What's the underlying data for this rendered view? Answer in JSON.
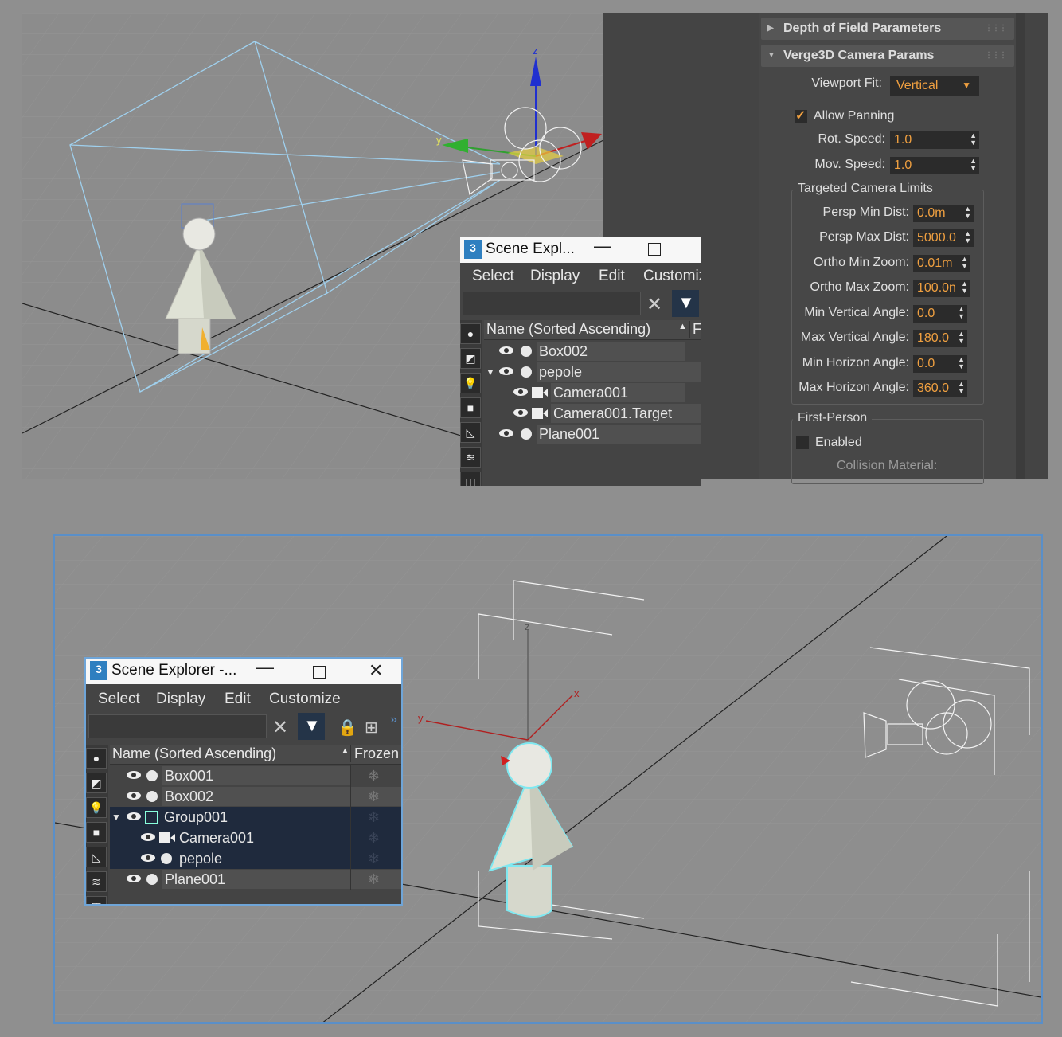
{
  "top_viewport": {
    "axis_labels": {
      "z": "z",
      "y": "y"
    }
  },
  "params_panel": {
    "rollouts": [
      {
        "label": "Depth of Field Parameters",
        "expanded": false
      },
      {
        "label": "Verge3D Camera Params",
        "expanded": true
      }
    ],
    "viewport_fit": {
      "label": "Viewport Fit:",
      "value": "Vertical"
    },
    "allow_panning": {
      "label": "Allow Panning",
      "checked": true
    },
    "rot_speed": {
      "label": "Rot. Speed:",
      "value": "1.0"
    },
    "mov_speed": {
      "label": "Mov. Speed:",
      "value": "1.0"
    },
    "targeted_limits": {
      "title": "Targeted Camera Limits",
      "fields": [
        {
          "label": "Persp Min Dist:",
          "value": "0.0m"
        },
        {
          "label": "Persp Max Dist:",
          "value": "5000.0"
        },
        {
          "label": "Ortho Min Zoom:",
          "value": "0.01m"
        },
        {
          "label": "Ortho Max Zoom:",
          "value": "100.0n"
        },
        {
          "label": "Min Vertical Angle:",
          "value": "0.0"
        },
        {
          "label": "Max Vertical Angle:",
          "value": "180.0"
        },
        {
          "label": "Min Horizon Angle:",
          "value": "0.0"
        },
        {
          "label": "Max Horizon Angle:",
          "value": "360.0"
        }
      ]
    },
    "first_person": {
      "title": "First-Person",
      "enabled_label": "Enabled",
      "enabled": false,
      "collision_label": "Collision Material:"
    }
  },
  "scene_explorer_top": {
    "title": "Scene Expl...",
    "app_icon_text": "3",
    "menu": [
      "Select",
      "Display",
      "Edit",
      "Customiz"
    ],
    "columns": [
      "Name (Sorted Ascending)",
      "Fr"
    ],
    "rows": [
      {
        "name": "Box002",
        "type": "object",
        "indent": 0
      },
      {
        "name": "pepole",
        "type": "object",
        "indent": 0,
        "expanded": true
      },
      {
        "name": "Camera001",
        "type": "camera",
        "indent": 1
      },
      {
        "name": "Camera001.Target",
        "type": "camera",
        "indent": 1
      },
      {
        "name": "Plane001",
        "type": "object",
        "indent": 0
      }
    ]
  },
  "bottom_viewport": {
    "axis_labels": {
      "z": "z",
      "x": "x",
      "y": "y"
    }
  },
  "scene_explorer_bottom": {
    "title": "Scene Explorer -...",
    "app_icon_text": "3",
    "menu": [
      "Select",
      "Display",
      "Edit",
      "Customize"
    ],
    "columns": [
      "Name (Sorted Ascending)",
      "Frozen"
    ],
    "rows": [
      {
        "name": "Box001",
        "type": "object",
        "indent": 0,
        "selected": false
      },
      {
        "name": "Box002",
        "type": "object",
        "indent": 0,
        "selected": false
      },
      {
        "name": "Group001",
        "type": "group",
        "indent": 0,
        "expanded": true,
        "selected": true
      },
      {
        "name": "Camera001",
        "type": "camera",
        "indent": 1,
        "selected": true
      },
      {
        "name": "pepole",
        "type": "object",
        "indent": 1,
        "selected": true
      },
      {
        "name": "Plane001",
        "type": "object",
        "indent": 0,
        "selected": false
      }
    ]
  },
  "colors": {
    "accent_orange": "#f0a040",
    "selection_blue": "#1f2a3d",
    "viewport_border": "#5a8fc8"
  }
}
